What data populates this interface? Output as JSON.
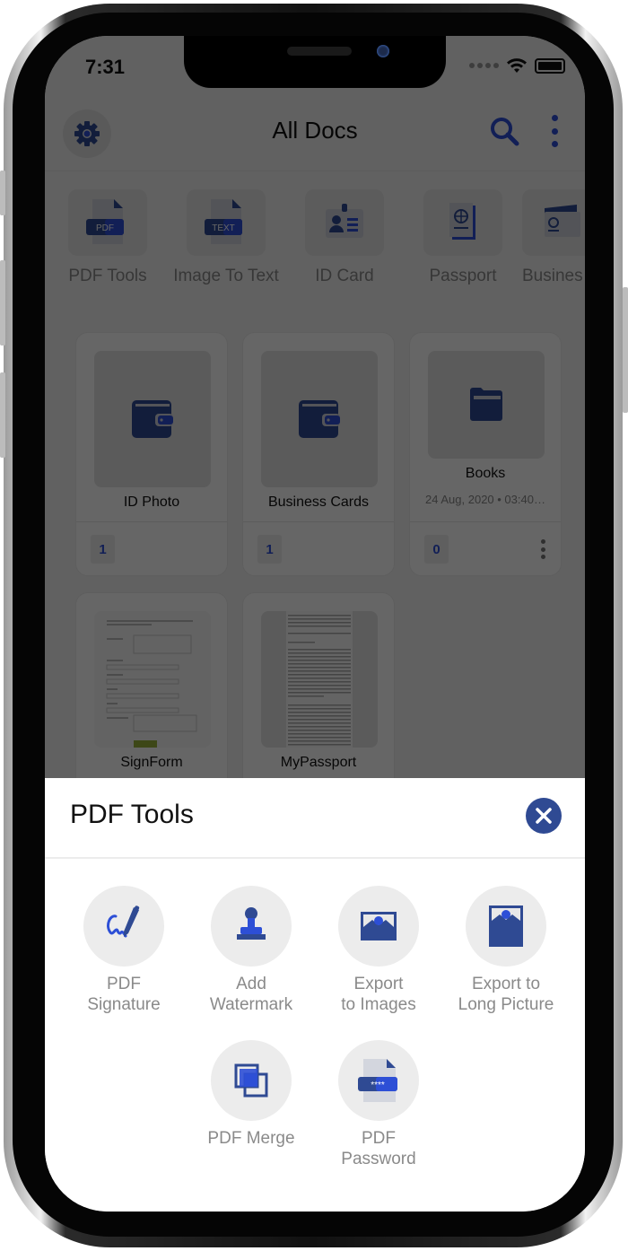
{
  "status_bar": {
    "time": "7:31"
  },
  "app_bar": {
    "title": "All Docs"
  },
  "categories": [
    {
      "label": "PDF Tools",
      "icon": "pdf-file-icon",
      "badge": "PDF"
    },
    {
      "label": "Image To Text",
      "icon": "text-file-icon",
      "badge": "TEXT"
    },
    {
      "label": "ID Card",
      "icon": "id-card-icon"
    },
    {
      "label": "Passport",
      "icon": "passport-icon"
    },
    {
      "label": "Busines",
      "icon": "business-card-icon"
    }
  ],
  "folders": [
    {
      "title": "ID Photo",
      "count": "1",
      "icon": "wallet-icon"
    },
    {
      "title": "Business Cards",
      "count": "1",
      "icon": "wallet-icon"
    },
    {
      "title": "Books",
      "date": "24 Aug, 2020 • 03:40…",
      "count": "0",
      "icon": "folder-icon"
    },
    {
      "title": "SignForm",
      "icon": "document-thumbnail"
    },
    {
      "title": "MyPassport",
      "icon": "document-thumbnail"
    }
  ],
  "sheet": {
    "title": "PDF Tools",
    "tools": [
      {
        "line1": "PDF",
        "line2": "Signature",
        "icon": "signature-pen-icon"
      },
      {
        "line1": "Add",
        "line2": "Watermark",
        "icon": "stamp-icon"
      },
      {
        "line1": "Export",
        "line2": "to Images",
        "icon": "image-icon"
      },
      {
        "line1": "Export to",
        "line2": "Long Picture",
        "icon": "long-picture-icon"
      },
      {
        "line1": "PDF Merge",
        "line2": "",
        "icon": "merge-icon"
      },
      {
        "line1": "PDF",
        "line2": "Password",
        "icon": "password-file-icon"
      },
      {
        "password_mask": "****"
      }
    ]
  },
  "colors": {
    "accent": "#2d4fd6",
    "navy": "#2f4a93",
    "overlay": "rgba(0,0,0,0.6)"
  }
}
